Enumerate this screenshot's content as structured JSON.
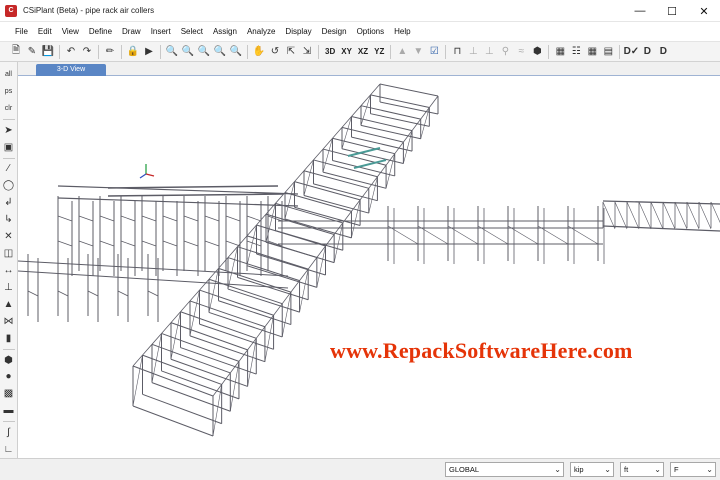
{
  "window": {
    "title": "CSiPlant (Beta) - pipe rack air collers",
    "app_icon_text": "C",
    "controls": {
      "minimize": "—",
      "maximize": "☐",
      "close": "✕"
    }
  },
  "menu": {
    "items": [
      "File",
      "Edit",
      "View",
      "Define",
      "Draw",
      "Insert",
      "Select",
      "Assign",
      "Analyze",
      "Display",
      "Design",
      "Options",
      "Help"
    ]
  },
  "toolbar": {
    "view_3d": "3D",
    "view_xy": "XY",
    "view_xz": "XZ",
    "view_yz": "YZ",
    "icons": [
      "new-icon",
      "open-icon",
      "save-icon",
      "undo-icon",
      "redo-icon",
      "lock-icon",
      "run-icon",
      "zoom-icons",
      "pan-icon",
      "view-icons",
      "design-icons"
    ]
  },
  "view": {
    "tab_label": "3-D View"
  },
  "watermark": "www.RepackSoftwareHere.com",
  "status": {
    "coord_system": "GLOBAL",
    "force_unit": "kip",
    "length_unit": "ft",
    "temp_unit": "F"
  },
  "colors": {
    "tab_active": "#5a86c5",
    "watermark": "#e53408",
    "structure": "#5c5c66"
  }
}
